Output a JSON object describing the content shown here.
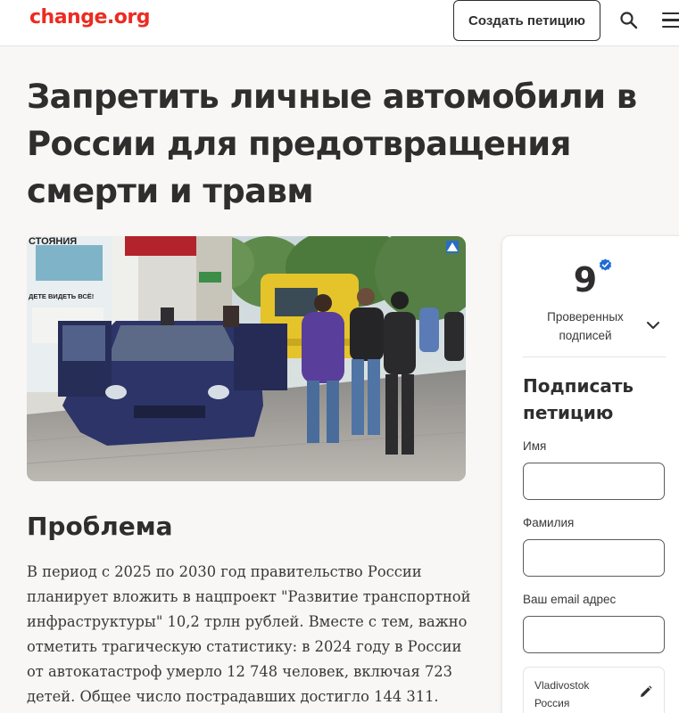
{
  "header": {
    "logo": "change.org",
    "create_button": "Создать петицию"
  },
  "petition": {
    "title": "Запретить личные автомобили в России для предотвращения смерти и травм",
    "section_title": "Проблема",
    "problem_text": "В период с 2025 по 2030 год правительство России планирует вложить в нацпроект \"Развитие транспортной инфраструктуры\" 10,2 трлн рублей. Вместе с тем, важно отметить трагическую статистику: в 2024 году в России от автокатастроф умерло 12 748 человек, включая 723 детей. Общее число пострадавших достигло 144 311."
  },
  "sign_card": {
    "signature_count": "9",
    "signature_label": "Проверенных подписей",
    "title": "Подписать петицию",
    "first_name_label": "Имя",
    "last_name_label": "Фамилия",
    "email_label": "Ваш email адрес",
    "location_city": "Vladivostok",
    "location_country": "Россия"
  },
  "photo_signage": {
    "store_top": "СТОЯНИЯ",
    "store_line": "ДЕТЕ ВИДЕТЬ ВСЁ!"
  },
  "colors": {
    "brand": "#ec2c22",
    "text": "#2f2d2e",
    "verified": "#1e6bd6"
  },
  "icons": [
    "search-icon",
    "menu-icon",
    "verified-icon",
    "chevron-down-icon",
    "pencil-icon"
  ]
}
